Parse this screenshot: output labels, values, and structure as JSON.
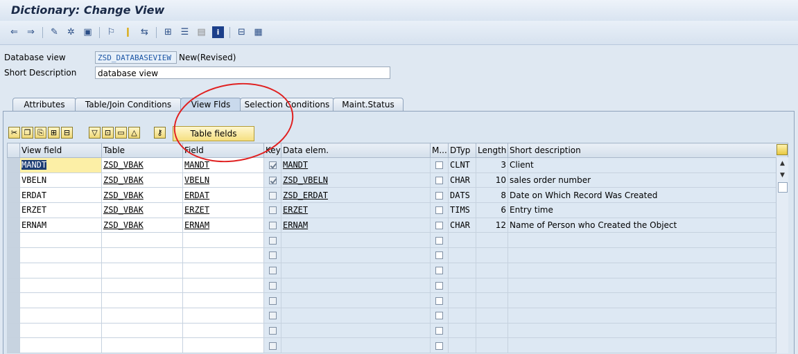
{
  "window": {
    "title": "Dictionary: Change View"
  },
  "toolbar": {
    "icons": [
      "back-arrow-icon",
      "forward-arrow-icon",
      "edit-pencil-icon",
      "display-change-icon",
      "activate-icon",
      "where-used-icon",
      "object-list-icon",
      "navigate-icon",
      "hierarchy-icon",
      "stack-icon",
      "layout-icon",
      "info-icon",
      "tree-icon",
      "grid-icon"
    ]
  },
  "header": {
    "db_view_label": "Database view",
    "db_view_value": "ZSD_DATABASEVIEW",
    "db_view_status": "New(Revised)",
    "short_desc_label": "Short Description",
    "short_desc_value": "database view"
  },
  "tabs": [
    {
      "label": "Attributes"
    },
    {
      "label": "Table/Join Conditions"
    },
    {
      "label": "View Flds"
    },
    {
      "label": "Selection Conditions"
    },
    {
      "label": "Maint.Status"
    }
  ],
  "table_fields_button": "Table fields",
  "grid": {
    "columns": [
      "View field",
      "Table",
      "Field",
      "Key",
      "Data elem.",
      "M...",
      "DTyp",
      "Length",
      "Short description"
    ],
    "rows": [
      {
        "view_field": "MANDT",
        "table": "ZSD_VBAK",
        "field": "MANDT",
        "key": true,
        "data_elem": "MANDT",
        "mod": false,
        "dtyp": "CLNT",
        "length": "3",
        "short_desc": "Client"
      },
      {
        "view_field": "VBELN",
        "table": "ZSD_VBAK",
        "field": "VBELN",
        "key": true,
        "data_elem": "ZSD_VBELN",
        "mod": false,
        "dtyp": "CHAR",
        "length": "10",
        "short_desc": "sales order number"
      },
      {
        "view_field": "ERDAT",
        "table": "ZSD_VBAK",
        "field": "ERDAT",
        "key": false,
        "data_elem": "ZSD_ERDAT",
        "mod": false,
        "dtyp": "DATS",
        "length": "8",
        "short_desc": "Date on Which Record Was Created"
      },
      {
        "view_field": "ERZET",
        "table": "ZSD_VBAK",
        "field": "ERZET",
        "key": false,
        "data_elem": "ERZET",
        "mod": false,
        "dtyp": "TIMS",
        "length": "6",
        "short_desc": "Entry time"
      },
      {
        "view_field": "ERNAM",
        "table": "ZSD_VBAK",
        "field": "ERNAM",
        "key": false,
        "data_elem": "ERNAM",
        "mod": false,
        "dtyp": "CHAR",
        "length": "12",
        "short_desc": "Name of Person who Created the Object"
      }
    ],
    "empty_rows": 8
  }
}
